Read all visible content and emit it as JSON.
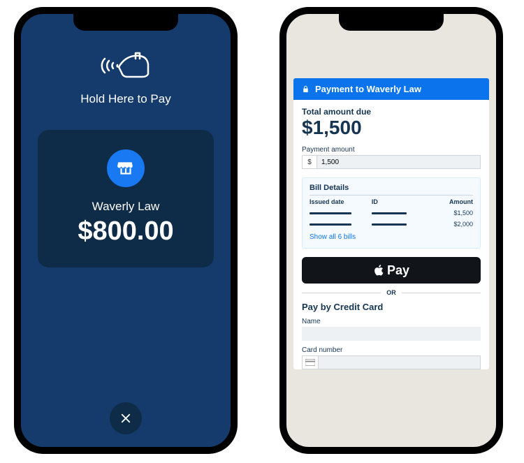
{
  "tap_to_pay": {
    "instruction": "Hold Here to Pay",
    "merchant": "Waverly Law",
    "amount": "$800.00"
  },
  "payment_form": {
    "header": "Payment to Waverly Law",
    "total_label": "Total amount due",
    "total_amount": "$1,500",
    "payment_amount_label": "Payment amount",
    "currency_prefix": "$",
    "payment_amount_value": "1,500",
    "bill_details": {
      "title": "Bill Details",
      "col_issued": "Issued date",
      "col_id": "ID",
      "col_amount": "Amount",
      "rows": [
        {
          "amount": "$1,500"
        },
        {
          "amount": "$2,000"
        }
      ],
      "show_all": "Show all 6 bills"
    },
    "apple_pay_label": "Pay",
    "or_label": "OR",
    "credit_card": {
      "title": "Pay by Credit Card",
      "name_label": "Name",
      "card_number_label": "Card number"
    }
  }
}
